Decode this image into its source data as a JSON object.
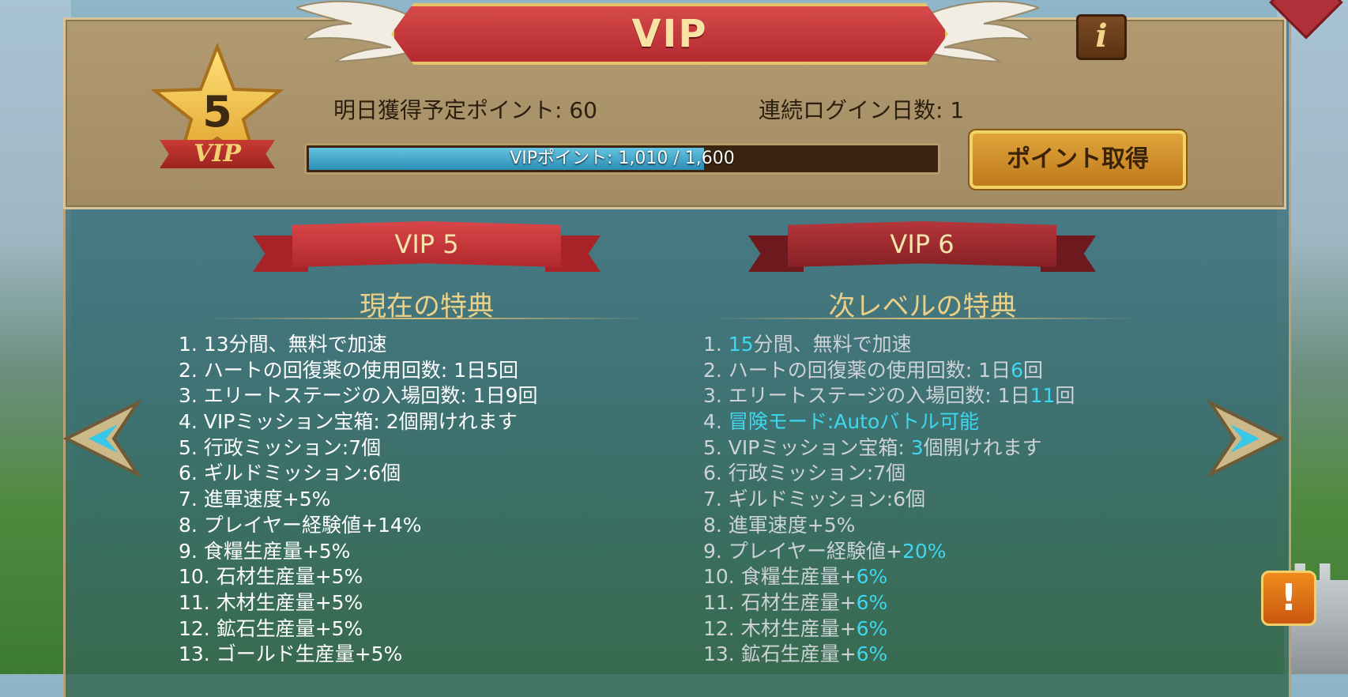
{
  "header": {
    "title": "VIP",
    "info_icon_glyph": "i",
    "vip_level": "5",
    "vip_label": "VIP",
    "tomorrow_points": "明日獲得予定ポイント: 60",
    "login_days": "連続ログイン日数: 1",
    "progress_text": "VIPポイント: 1,010 / 1,600",
    "progress_fraction": 0.631,
    "get_points_label": "ポイント取得"
  },
  "current": {
    "ribbon": "VIP 5",
    "heading": "現在の特典",
    "perks": [
      "1. 13分間、無料で加速",
      "2. ハートの回復薬の使用回数: 1日5回",
      "3. エリートステージの入場回数: 1日9回",
      "4. VIPミッション宝箱: 2個開けれます",
      "5. 行政ミッション:7個",
      "6. ギルドミッション:6個",
      "7. 進軍速度+5%",
      "8. プレイヤー経験値+14%",
      "9. 食糧生産量+5%",
      "10. 石材生産量+5%",
      "11. 木材生産量+5%",
      "12. 鉱石生産量+5%",
      "13. ゴールド生産量+5%"
    ]
  },
  "next": {
    "ribbon": "VIP 6",
    "heading": "次レベルの特典",
    "perks": [
      {
        "pre": "1. ",
        "hl": "15",
        "post": "分間、無料で加速"
      },
      {
        "pre": "2. ハートの回復薬の使用回数: 1日",
        "hl": "6",
        "post": "回"
      },
      {
        "pre": "3. エリートステージの入場回数: 1日",
        "hl": "11",
        "post": "回"
      },
      {
        "pre": "4. ",
        "hl": "冒険モード:Autoバトル可能",
        "post": ""
      },
      {
        "pre": "5. VIPミッション宝箱: ",
        "hl": "3",
        "post": "個開けれます"
      },
      {
        "pre": "6. 行政ミッション:7個",
        "hl": "",
        "post": ""
      },
      {
        "pre": "7. ギルドミッション:6個",
        "hl": "",
        "post": ""
      },
      {
        "pre": "8. 進軍速度+5%",
        "hl": "",
        "post": ""
      },
      {
        "pre": "9. プレイヤー経験値+",
        "hl": "20%",
        "post": ""
      },
      {
        "pre": "10. 食糧生産量+",
        "hl": "6%",
        "post": ""
      },
      {
        "pre": "11. 石材生産量+",
        "hl": "6%",
        "post": ""
      },
      {
        "pre": "12. 木材生産量+",
        "hl": "6%",
        "post": ""
      },
      {
        "pre": "13. 鉱石生産量+",
        "hl": "6%",
        "post": ""
      }
    ]
  },
  "alert_glyph": "!",
  "colors": {
    "highlight": "#3fd7f0",
    "title_red": "#c23a3e",
    "gold": "#e4c36a"
  },
  "icons": [
    "wing-icon",
    "info-icon",
    "vip-star-icon",
    "arrow-left-icon",
    "arrow-right-icon",
    "alert-icon"
  ]
}
